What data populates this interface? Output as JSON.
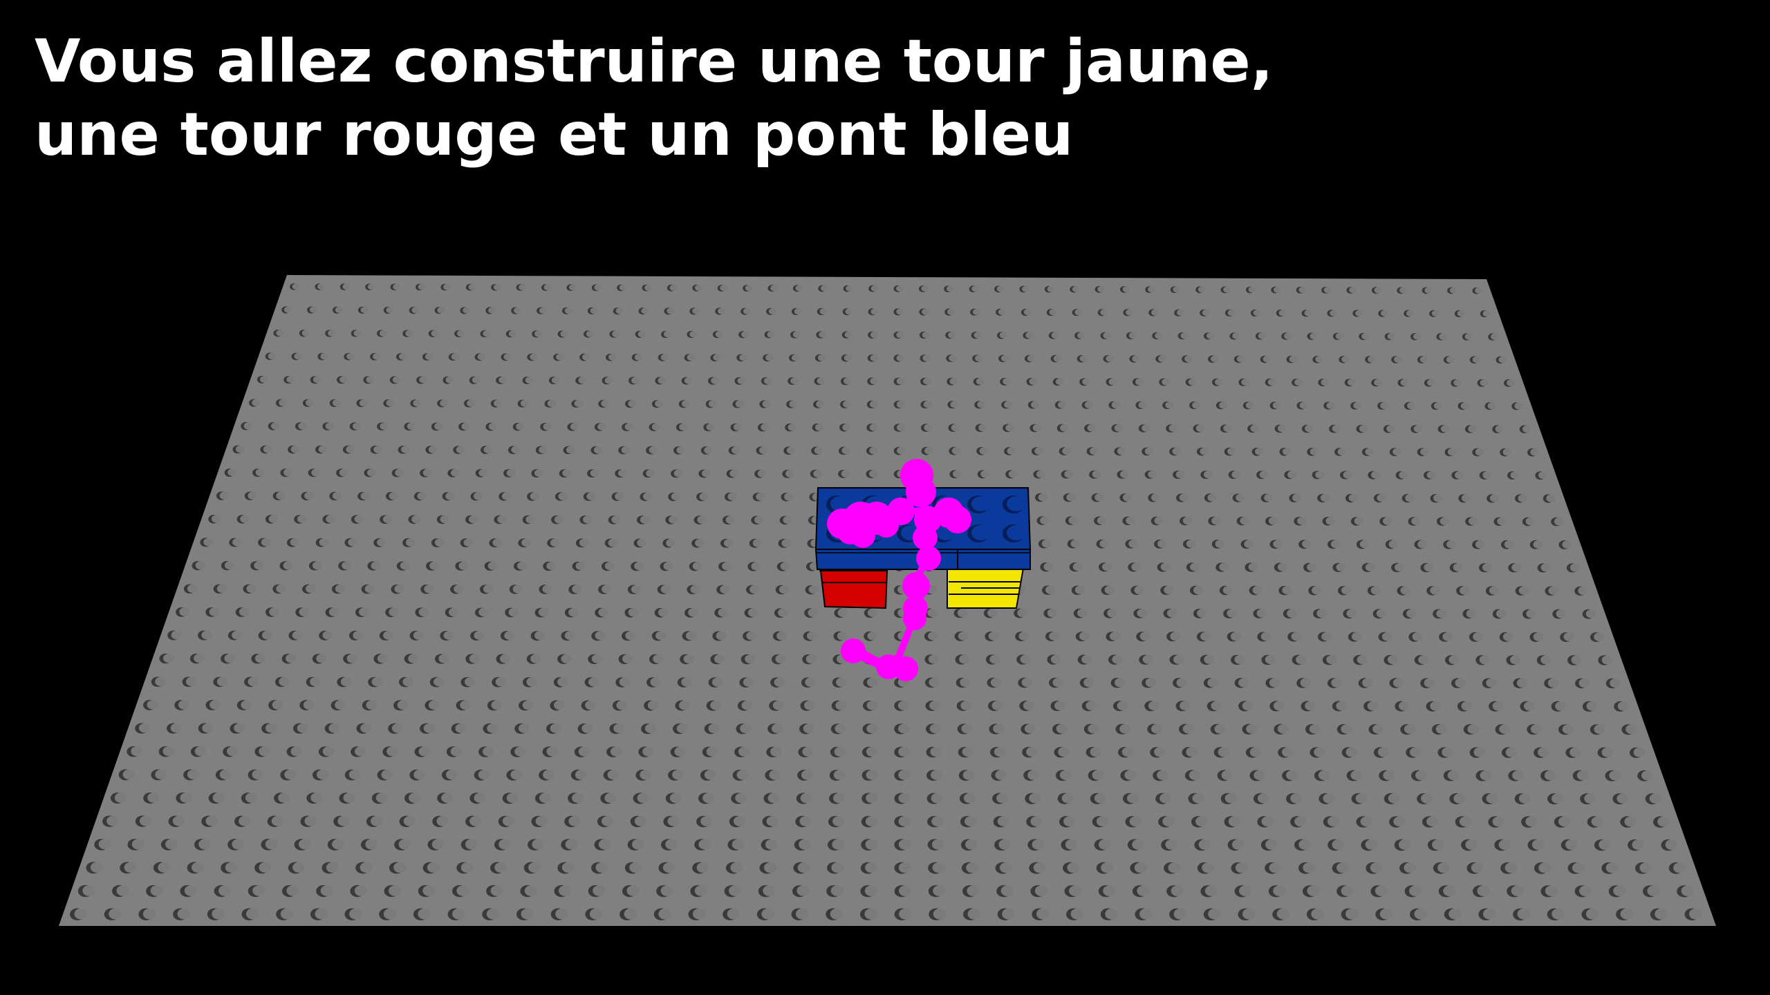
{
  "instruction": {
    "line1": "Vous allez construire une tour jaune,",
    "line2": "une tour rouge et un pont bleu"
  },
  "colors": {
    "background": "#000000",
    "baseplate": "#808080",
    "stud_shadow": "#3a3a3a",
    "stud_top": "#7b7b7b",
    "brick_blue": "#0a3a9c",
    "brick_red": "#d40000",
    "brick_yellow": "#f2e600",
    "trace_magenta": "#ff00ff"
  },
  "scene": {
    "baseplate_studs": {
      "columns": 48,
      "rows": 28
    },
    "bricks": [
      {
        "name": "yellow-tower",
        "color": "brick_yellow"
      },
      {
        "name": "red-tower",
        "color": "brick_red"
      },
      {
        "name": "blue-bridge",
        "color": "brick_blue"
      }
    ]
  }
}
